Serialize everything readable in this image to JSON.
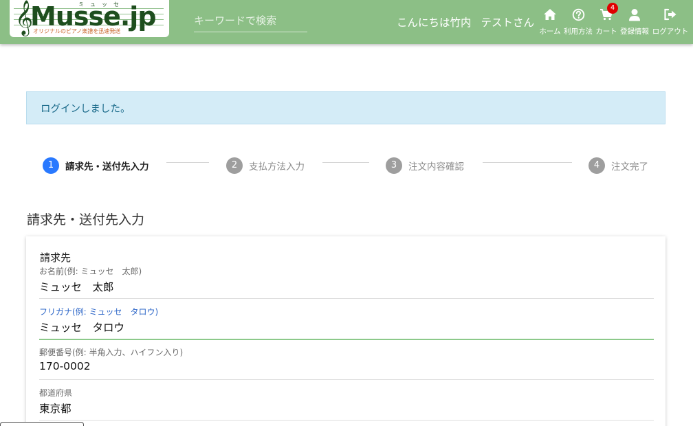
{
  "header": {
    "logo": {
      "kana": "ミュッセ",
      "text": "Musse.jp",
      "subtitle": "オリジナルのピアノ楽譜を迅速発送"
    },
    "search_placeholder": "キーワードで検索",
    "greeting": {
      "prefix": "こんにちは竹内",
      "name": "テストさん"
    },
    "nav": [
      {
        "label": "ホーム",
        "icon": "home-icon"
      },
      {
        "label": "利用方法",
        "icon": "question-circle-icon"
      },
      {
        "label": "カート",
        "icon": "cart-icon",
        "badge": "4"
      },
      {
        "label": "登録情報",
        "icon": "user-icon"
      },
      {
        "label": "ログアウト",
        "icon": "logout-icon"
      }
    ],
    "colors": {
      "header_bg": "#8cbf86",
      "badge": "#e00000"
    }
  },
  "alert": {
    "message": "ログインしました。"
  },
  "stepper": {
    "steps": [
      {
        "number": "1",
        "label": "請求先・送付先入力",
        "active": true
      },
      {
        "number": "2",
        "label": "支払方法入力",
        "active": false
      },
      {
        "number": "3",
        "label": "注文内容確認",
        "active": false
      },
      {
        "number": "4",
        "label": "注文完了",
        "active": false
      }
    ],
    "active_color": "#2979ff"
  },
  "section_title": "請求先・送付先入力",
  "billing": {
    "heading": "請求先",
    "fields": [
      {
        "label": "お名前(例: ミュッセ　太郎)",
        "value": "ミュッセ　太郎"
      },
      {
        "label": "フリガナ(例: ミュッセ　タロウ)",
        "value": "ミュッセ　タロウ",
        "focused": true
      },
      {
        "label": "郵便番号(例: 半角入力、ハイフン入り)",
        "value": "170-0002"
      },
      {
        "label": "都道府県",
        "value": "東京都"
      }
    ]
  }
}
